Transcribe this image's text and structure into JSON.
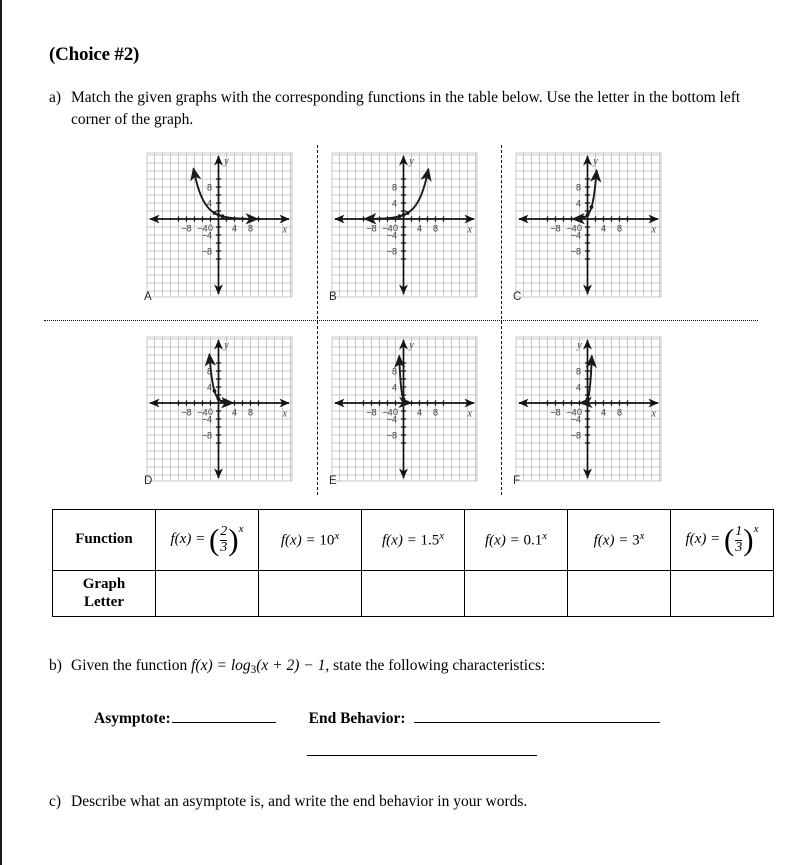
{
  "header": {
    "choice_title": "(Choice #2)"
  },
  "questions": {
    "a": {
      "marker": "a)",
      "text": "Match the given graphs with the corresponding functions in the table below. Use the letter in the bottom left corner of the graph."
    },
    "b": {
      "marker": "b)",
      "text_before": "Given the function ",
      "fn_f": "f",
      "fn_x": "(x) = ",
      "fn_log": "log",
      "fn_base": "3",
      "fn_arg": "(x + 2) − 1",
      "text_after": ", state the following characteristics:",
      "asymptote_label": "Asymptote:",
      "end_behavior_label": "End Behavior:"
    },
    "c": {
      "marker": "c)",
      "text": "Describe what an asymptote is, and write the end behavior in your words."
    }
  },
  "graph_panels": [
    {
      "letter": "A",
      "function": "f(x) = (2/3)^x",
      "kind": "decay",
      "base": 0.667,
      "description": "Decreasing exponential decay curve approaching the x-axis on the right, rising steeply at upper left"
    },
    {
      "letter": "B",
      "function": "f(x) = 1.5^x",
      "kind": "growth",
      "base": 1.5,
      "description": "Slowly increasing exponential growth curve approaching the x-axis on the left"
    },
    {
      "letter": "C",
      "function": "f(x) = 3^x",
      "kind": "growth",
      "base": 3,
      "description": "Steep exponential growth curve approaching the x-axis on the left"
    },
    {
      "letter": "D",
      "function": "f(x) = (1/3)^x",
      "kind": "decay",
      "base": 0.3333,
      "description": "Steep exponential decay curve approaching the x-axis on the right"
    },
    {
      "letter": "E",
      "function": "f(x) = 0.1^x",
      "kind": "decay",
      "base": 0.1,
      "description": "Very steep exponential decay curve, nearly vertical near the y-axis"
    },
    {
      "letter": "F",
      "function": "f(x) = 10^x",
      "kind": "growth",
      "base": 10,
      "description": "Very steep exponential growth curve, nearly vertical near the y-axis"
    }
  ],
  "axis": {
    "x_label": "x",
    "y_label": "y",
    "origin_label": "0",
    "x_ticks": [
      "−8",
      "−4",
      "4",
      "8"
    ],
    "y_ticks": [
      "8",
      "4",
      "−4",
      "−8"
    ],
    "x_min": -11,
    "x_max": 11,
    "y_min": -11,
    "y_max": 11
  },
  "function_table": {
    "row_header_function": "Function",
    "row_header_graph_letter_line1": "Graph",
    "row_header_graph_letter_line2": "Letter",
    "columns": [
      {
        "type": "fraction_power",
        "lhs": "f(x) = ",
        "num": "2",
        "den": "3",
        "exp": "x",
        "plain": "f(x) = (2/3)^x"
      },
      {
        "type": "simple_power",
        "lhs": "f(x) = ",
        "base": "10",
        "exp": "x",
        "plain": "f(x) = 10^x"
      },
      {
        "type": "simple_power",
        "lhs": "f(x) = ",
        "base": "1.5",
        "exp": "x",
        "plain": "f(x) = 1.5^x"
      },
      {
        "type": "simple_power",
        "lhs": "f(x) = ",
        "base": "0.1",
        "exp": "x",
        "plain": "f(x) = 0.1^x"
      },
      {
        "type": "simple_power",
        "lhs": "f(x) = ",
        "base": "3",
        "exp": "x",
        "plain": "f(x) = 3^x"
      },
      {
        "type": "fraction_power",
        "lhs": "f(x) = ",
        "num": "1",
        "den": "3",
        "exp": "x",
        "plain": "f(x) = (1/3)^x"
      }
    ],
    "answers": [
      "",
      "",
      "",
      "",
      "",
      ""
    ]
  },
  "colors": {
    "ink": "#000000",
    "grid": "#c8c8c8",
    "curve": "#1a1a1a",
    "axis": "#111111",
    "tick_label": "#3a3a3a"
  }
}
